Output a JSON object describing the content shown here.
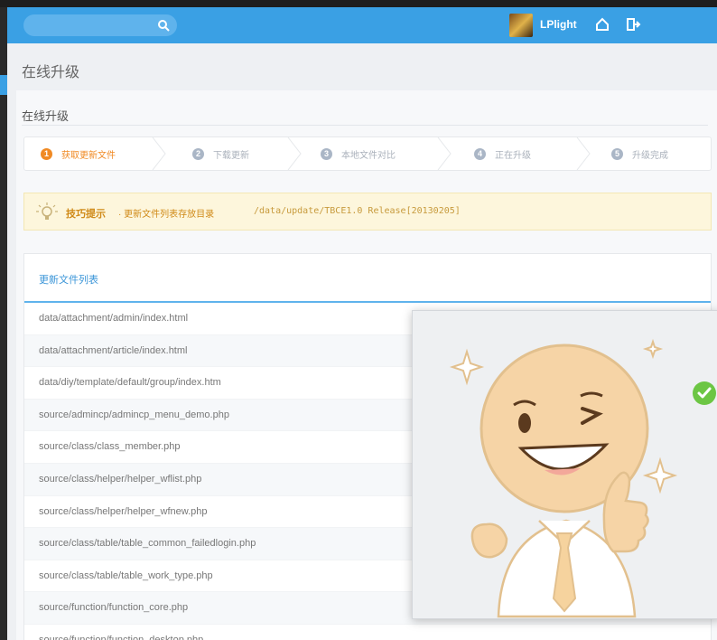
{
  "header": {
    "search_placeholder": "",
    "user_name": "LPlight",
    "icons": [
      "search-icon",
      "home-icon",
      "logout-icon"
    ]
  },
  "page_title": "在线升级",
  "section_title": "在线升级",
  "steps": [
    {
      "num": "1",
      "label": "获取更新文件",
      "active": true
    },
    {
      "num": "2",
      "label": "下载更新",
      "active": false
    },
    {
      "num": "3",
      "label": "本地文件对比",
      "active": false
    },
    {
      "num": "4",
      "label": "正在升级",
      "active": false
    },
    {
      "num": "5",
      "label": "升级完成",
      "active": false
    }
  ],
  "tip": {
    "label": "技巧提示",
    "text": "· 更新文件列表存放目录",
    "path": "/data/update/TBCE1.0 Release[20130205]"
  },
  "files": {
    "title": "更新文件列表",
    "rows": [
      "data/attachment/admin/index.html",
      "data/attachment/article/index.html",
      "data/diy/template/default/group/index.htm",
      "source/admincp/admincp_menu_demo.php",
      "source/class/class_member.php",
      "source/class/helper/helper_wflist.php",
      "source/class/helper/helper_wfnew.php",
      "source/class/table/table_common_failedlogin.php",
      "source/class/table/table_work_type.php",
      "source/function/function_core.php",
      "source/function/function_desktop.php"
    ]
  },
  "colors": {
    "topbar": "#3aa0e4",
    "active_step": "#f08a24",
    "link": "#3a95d8",
    "tip_bg": "#fdf6dc",
    "success": "#6cc644"
  }
}
